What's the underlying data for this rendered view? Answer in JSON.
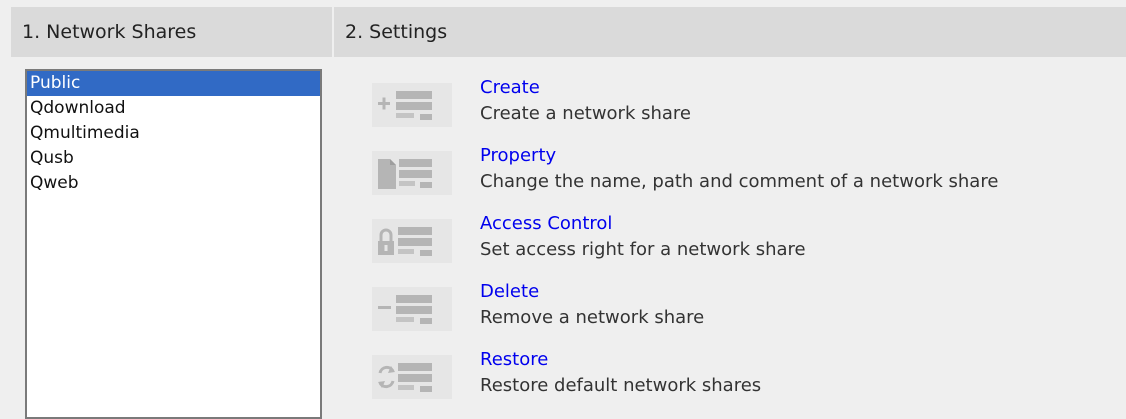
{
  "headers": {
    "left": "1. Network Shares",
    "right": "2. Settings"
  },
  "shares": [
    {
      "name": "Public",
      "selected": true
    },
    {
      "name": "Qdownload",
      "selected": false
    },
    {
      "name": "Qmultimedia",
      "selected": false
    },
    {
      "name": "Qusb",
      "selected": false
    },
    {
      "name": "Qweb",
      "selected": false
    }
  ],
  "actions": [
    {
      "icon": "create-share-icon",
      "title": "Create",
      "description": "Create a network share"
    },
    {
      "icon": "property-share-icon",
      "title": "Property",
      "description": "Change the name, path and comment of a network share"
    },
    {
      "icon": "access-control-lock-icon",
      "title": "Access Control",
      "description": "Set access right for a network share"
    },
    {
      "icon": "delete-share-icon",
      "title": "Delete",
      "description": "Remove a network share"
    },
    {
      "icon": "restore-share-icon",
      "title": "Restore",
      "description": "Restore default network shares"
    }
  ],
  "colors": {
    "selection": "#316ac5",
    "link": "#0000ee",
    "header_bg": "#dadada",
    "panel_bg": "#efefef"
  }
}
